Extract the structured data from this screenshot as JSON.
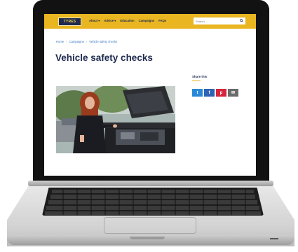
{
  "header": {
    "logo_text": "TYRES",
    "nav": [
      "About ▾",
      "Advice ▾",
      "Education",
      "Campaigns",
      "FAQs"
    ],
    "search_placeholder": "Search ..."
  },
  "breadcrumb": [
    "Home",
    "Campaigns",
    "Vehicle safety checks"
  ],
  "page": {
    "title": "Vehicle safety checks"
  },
  "share": {
    "label": "Share this",
    "buttons": [
      {
        "icon": "twitter-icon",
        "glyph": "t",
        "color": "#2b88d9"
      },
      {
        "icon": "facebook-icon",
        "glyph": "f",
        "color": "#2f63b5"
      },
      {
        "icon": "pinterest-icon",
        "glyph": "p",
        "color": "#d5263b"
      },
      {
        "icon": "email-icon",
        "glyph": "✉",
        "color": "#6b6b6b"
      }
    ]
  }
}
